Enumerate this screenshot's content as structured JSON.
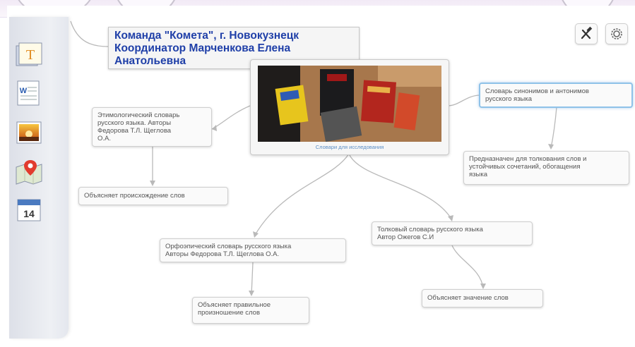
{
  "title_node": {
    "text": "Команда \"Комета\", г. Новокузнецк\nКоординатор Марченкова Елена\nАнатольевна"
  },
  "central_node": {
    "caption": "Словари для исследования"
  },
  "nodes": {
    "etymological": "Этимологический словарь\nрусского языка. Авторы\nФедорова Т.Л. Щеглова\nО.А.",
    "etymological_purpose": "Объясняет происхождение слов",
    "synonyms": "Словарь синонимов и антонимов\nрусского языка",
    "synonyms_purpose": "Предназначен для толкования слов и\nустойчивых сочетаний, обогащения\nязыка",
    "orthoepic": "Орфоэпический словарь русского языка\nАвторы  Федорова Т.Л. Щеглова О.А.",
    "orthoepic_purpose": "Объясняет правильное\nпроизношение слов",
    "explanatory": "Толковый словарь русского языка\nАвтор Ожегов С.И",
    "explanatory_purpose": "Объясняет значение слов"
  },
  "sidebar": {
    "text_tool_letter": "T",
    "doc_tool_letter": "W",
    "calendar_day": "14"
  },
  "icons": {
    "text_tool": "text-icon",
    "document_tool": "word-document-icon",
    "image_tool": "image-icon",
    "map_tool": "map-pin-icon",
    "calendar_tool": "calendar-icon",
    "tools_button": "hammer-wrench-icon",
    "settings_button": "gear-icon"
  },
  "colors": {
    "title_text": "#1f3fa8",
    "node_text": "#555555",
    "caption_text": "#5b8fc7",
    "selected_border": "#8fc2e8"
  }
}
